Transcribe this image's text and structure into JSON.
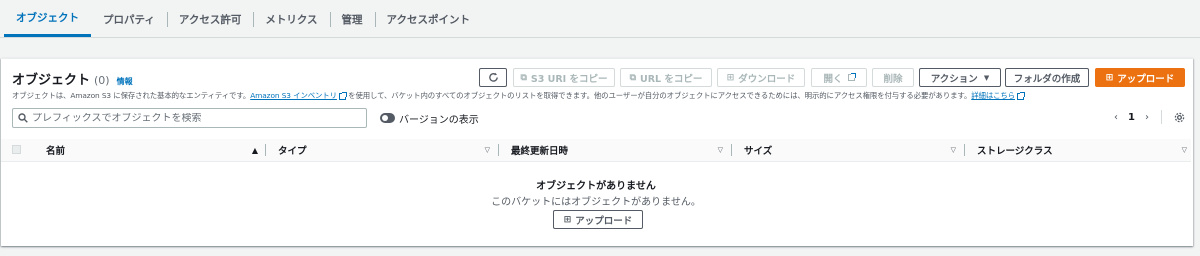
{
  "tabs": [
    {
      "label": "オブジェクト"
    },
    {
      "label": "プロパティ"
    },
    {
      "label": "アクセス許可"
    },
    {
      "label": "メトリクス"
    },
    {
      "label": "管理"
    },
    {
      "label": "アクセスポイント"
    }
  ],
  "objects": {
    "title": "オブジェクト",
    "count": "(0)",
    "info": "情報",
    "desc_part1": "オブジェクトは、Amazon S3 に保存された基本的なエンティティです。",
    "desc_link1": "Amazon S3 インベントリ",
    "desc_part2": "を使用して、バケット内のすべてのオブジェクトのリストを取得できます。他のユーザーが自分のオブジェクトにアクセスできるためには、明示的にアクセス権限を付与する必要があります。",
    "desc_link2": "詳細はこちら"
  },
  "toolbar": {
    "refresh_icon": "refresh-icon",
    "copy_s3_uri": "S3 URI をコピー",
    "copy_url": "URL をコピー",
    "download": "ダウンロード",
    "open": "開く",
    "delete": "削除",
    "actions": "アクション",
    "create_folder": "フォルダの作成",
    "upload": "アップロード"
  },
  "search": {
    "placeholder": "プレフィックスでオブジェクトを検索",
    "value": ""
  },
  "versions_toggle": {
    "label": "バージョンの表示",
    "on": false
  },
  "pagination": {
    "page": "1"
  },
  "table": {
    "columns": [
      {
        "label": "名前",
        "sort": "ascending"
      },
      {
        "label": "タイプ"
      },
      {
        "label": "最終更新日時"
      },
      {
        "label": "サイズ"
      },
      {
        "label": "ストレージクラス"
      }
    ]
  },
  "empty": {
    "title": "オブジェクトがありません",
    "subtitle": "このバケットにはオブジェクトがありません。",
    "upload": "アップロード"
  },
  "colors": {
    "accent": "#0073bb",
    "primary_button": "#ec7211"
  }
}
